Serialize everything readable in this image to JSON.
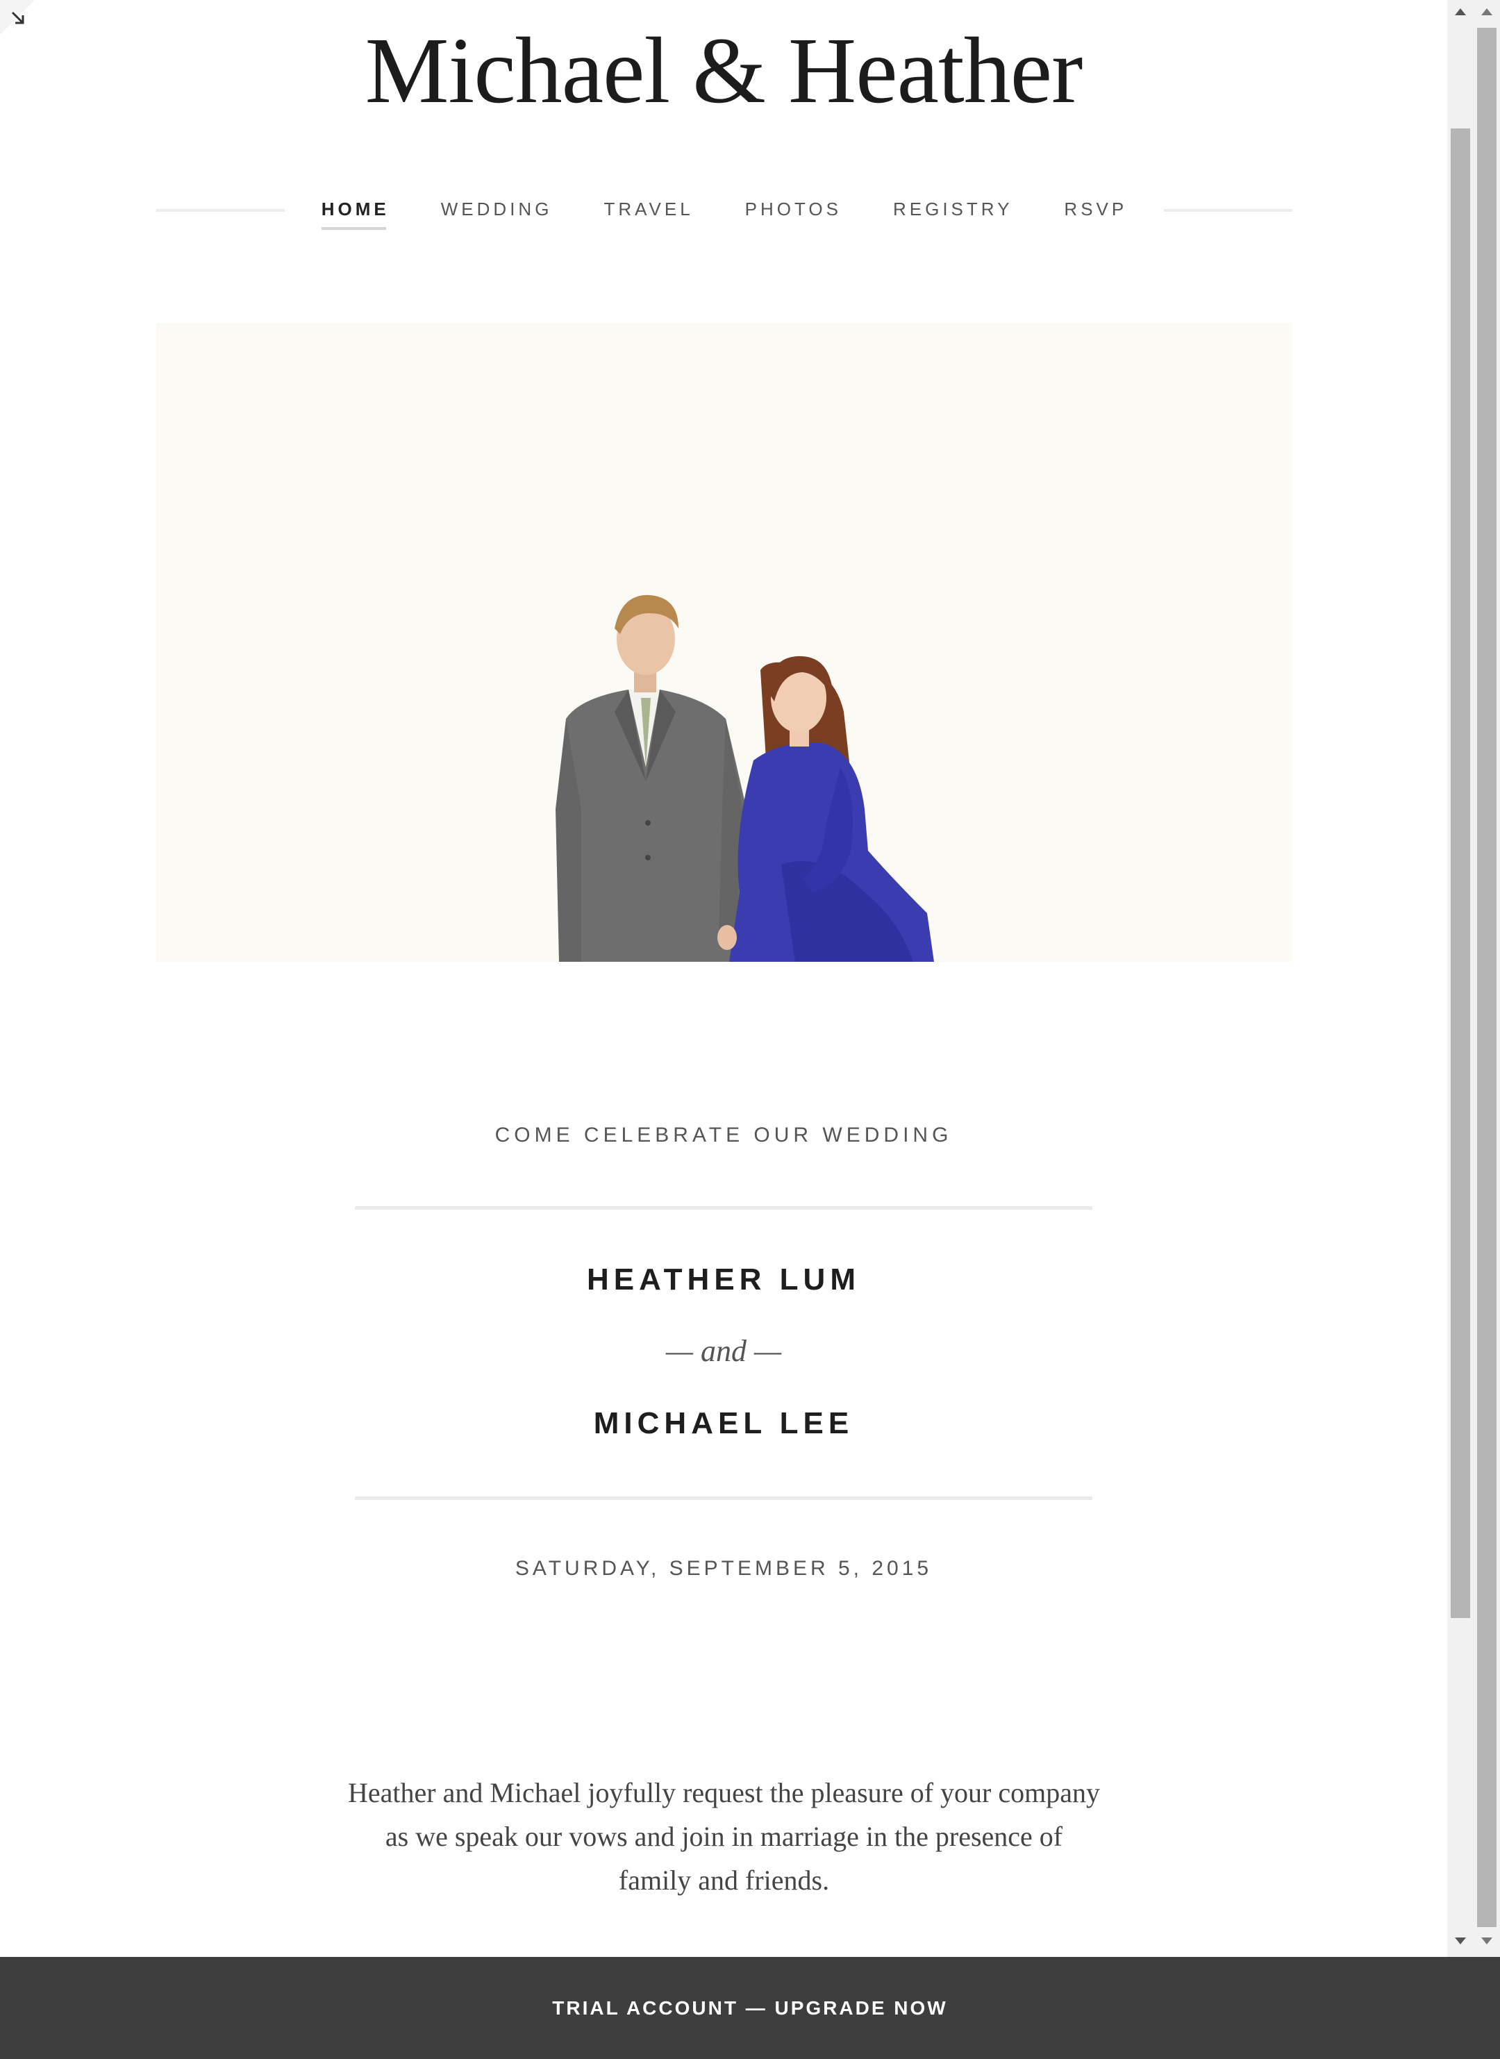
{
  "site": {
    "title": "Michael & Heather"
  },
  "nav": {
    "items": [
      {
        "label": "HOME",
        "active": true
      },
      {
        "label": "WEDDING",
        "active": false
      },
      {
        "label": "TRAVEL",
        "active": false
      },
      {
        "label": "PHOTOS",
        "active": false
      },
      {
        "label": "REGISTRY",
        "active": false
      },
      {
        "label": "RSVP",
        "active": false
      }
    ]
  },
  "hero": {
    "background_color": "#fbfaf4",
    "subject_colors": {
      "suit": "#6b6b6b",
      "dress": "#3b3cb0",
      "hair_her": "#7a3e22",
      "hair_him": "#b8894e"
    }
  },
  "invitation": {
    "kicker": "COME CELEBRATE OUR WEDDING",
    "bride": "HEATHER LUM",
    "connector": "— and —",
    "groom": "MICHAEL LEE",
    "date": "SATURDAY, SEPTEMBER 5, 2015",
    "message": "Heather and Michael joyfully request the pleasure of your company as we speak our vows and join in marriage in the presence of family and friends."
  },
  "banner": {
    "text": "TRIAL ACCOUNT — UPGRADE NOW",
    "background": "#3e3e3e"
  },
  "icons": {
    "corner": "expand-arrow-icon",
    "scroll_up": "scroll-up-arrow-icon",
    "scroll_down": "scroll-down-arrow-icon"
  }
}
